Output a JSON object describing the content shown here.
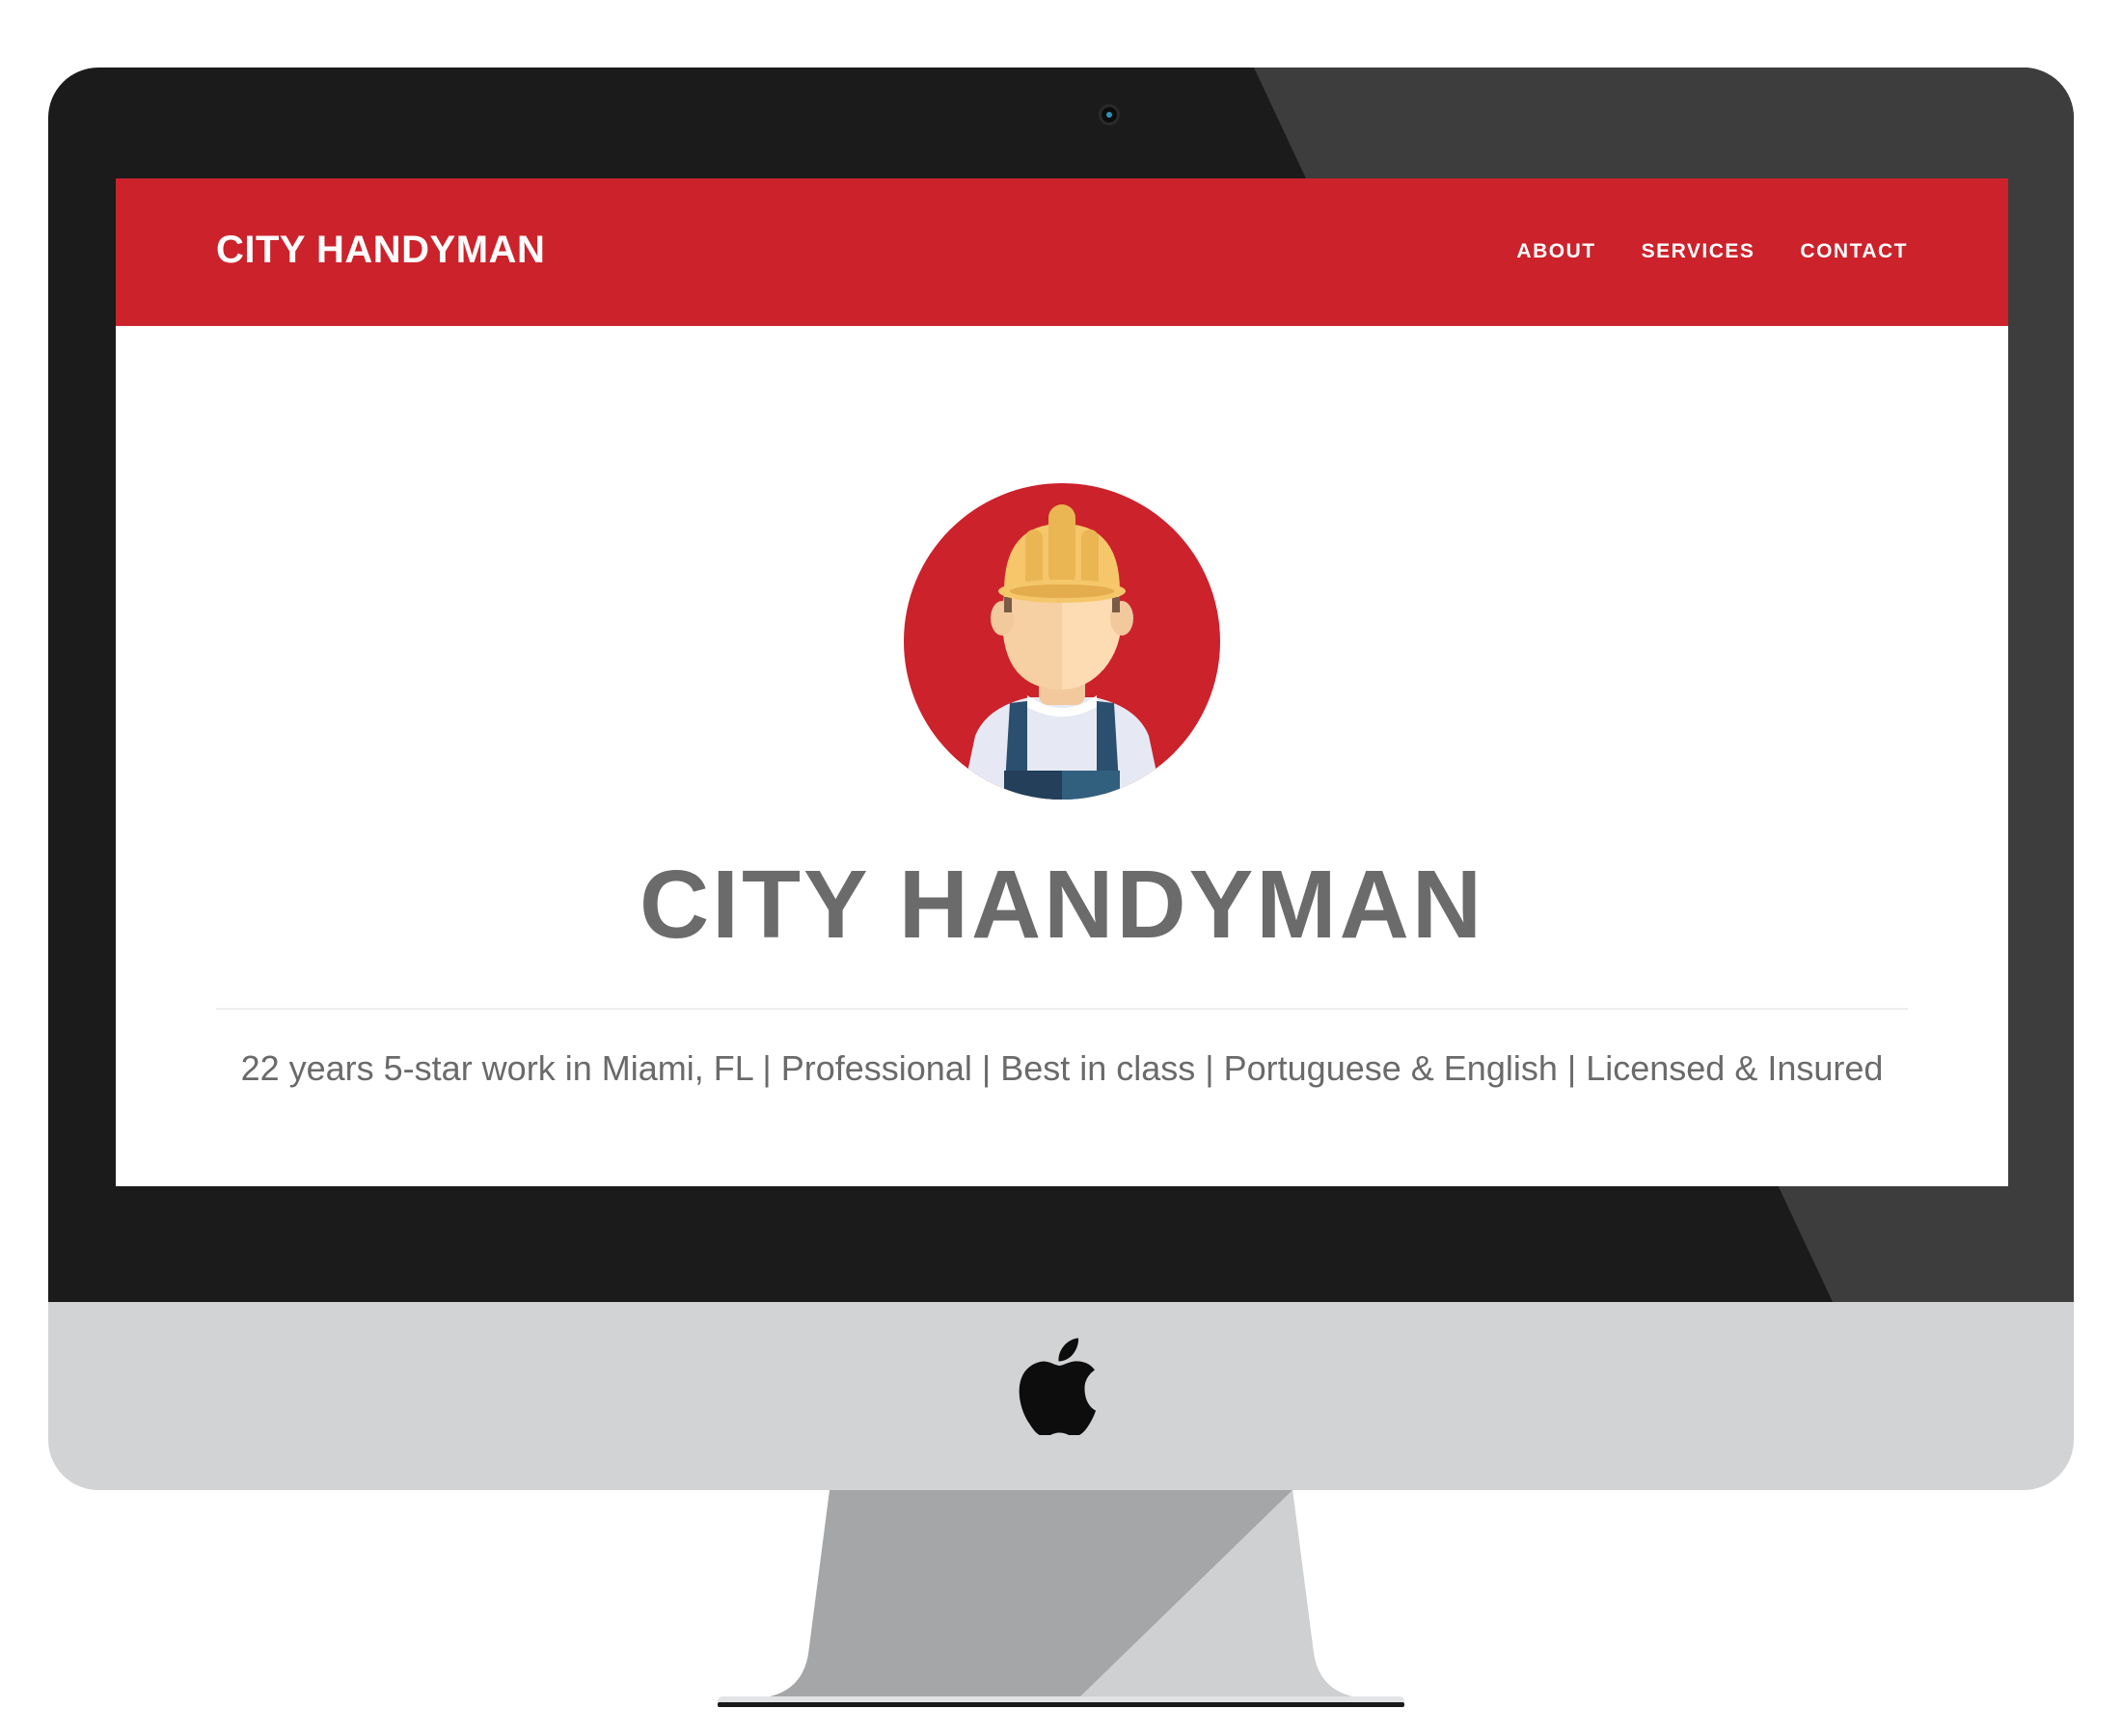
{
  "site": {
    "brand": "CITY HANDYMAN",
    "nav": [
      {
        "label": "ABOUT"
      },
      {
        "label": "SERVICES"
      },
      {
        "label": "CONTACT"
      }
    ]
  },
  "hero": {
    "avatar_icon": "handyman-avatar-icon",
    "title": "CITY HANDYMAN",
    "tagline": "22 years 5-star work in Miami, FL | Professional | Best in class | Portuguese & English | Licensed & Insured"
  },
  "colors": {
    "brand_red": "#cc222b",
    "text_gray": "#6b6b6b",
    "bezel": "#1b1b1b",
    "chin": "#d2d3d5"
  }
}
